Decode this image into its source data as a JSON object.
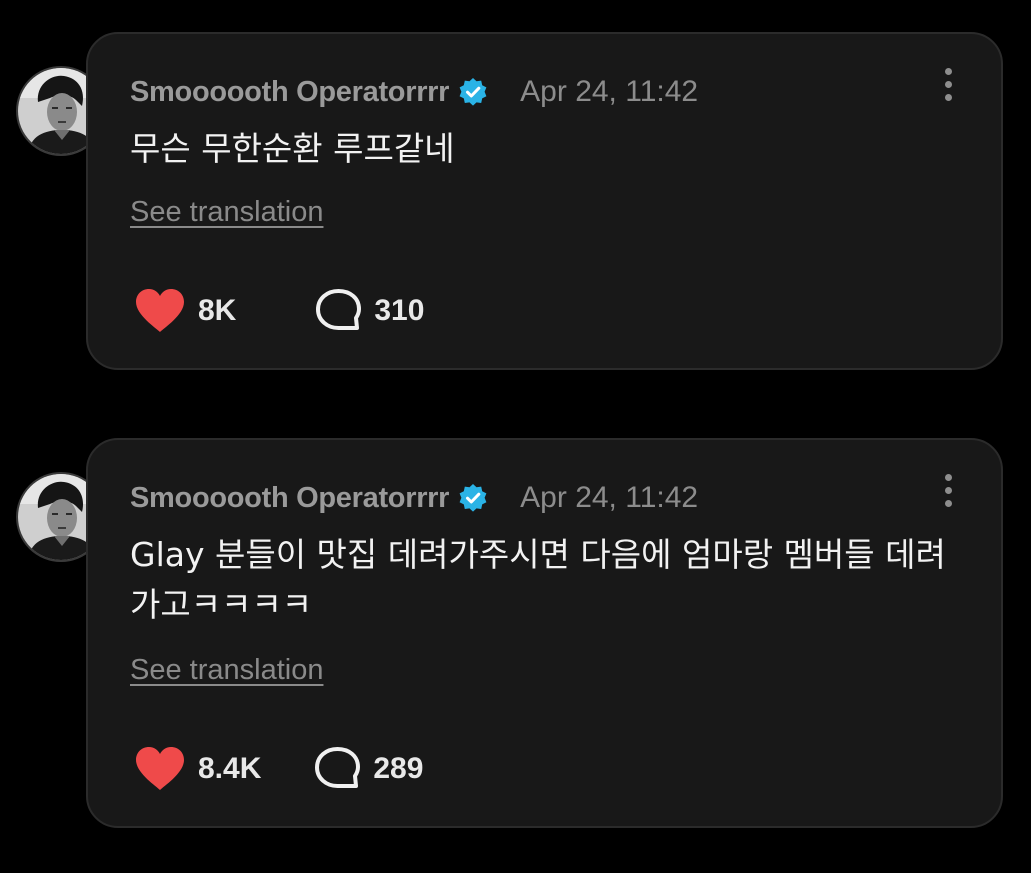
{
  "colors": {
    "background": "#000000",
    "card": "#181818",
    "like": "#ef4a4a",
    "verified": "#2ab3e6"
  },
  "posts": [
    {
      "author": "Smoooooth Operatorrrr",
      "verified_icon": "verified-badge-icon",
      "timestamp": "Apr 24, 11:42",
      "content": "무슨 무한순환 루프같네",
      "see_translation": "See translation",
      "likes": "8K",
      "comments": "310"
    },
    {
      "author": "Smoooooth Operatorrrr",
      "verified_icon": "verified-badge-icon",
      "timestamp": "Apr 24, 11:42",
      "content": "Glay 분들이 맛집 데려가주시면 다음에 엄마랑 멤버들 데려가고ㅋㅋㅋㅋ",
      "see_translation": "See translation",
      "likes": "8.4K",
      "comments": "289"
    }
  ]
}
